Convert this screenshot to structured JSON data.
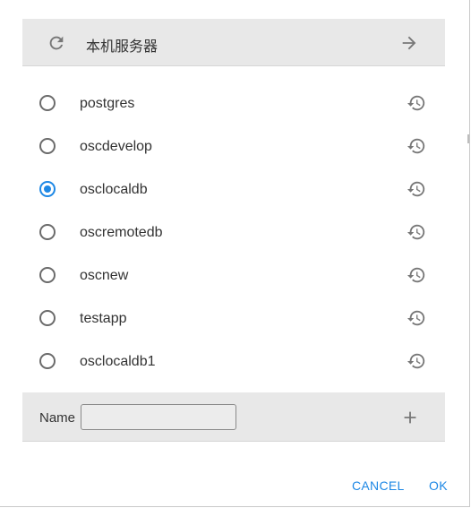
{
  "server": {
    "name": "本机服务器",
    "refresh_icon": "refresh-icon",
    "go_icon": "arrow-right-icon"
  },
  "databases": [
    {
      "name": "postgres",
      "selected": false
    },
    {
      "name": "oscdevelop",
      "selected": false
    },
    {
      "name": "osclocaldb",
      "selected": true
    },
    {
      "name": "oscremotedb",
      "selected": false
    },
    {
      "name": "oscnew",
      "selected": false
    },
    {
      "name": "testapp",
      "selected": false
    },
    {
      "name": "osclocaldb1",
      "selected": false
    }
  ],
  "add": {
    "label": "Name",
    "value": "",
    "add_icon": "plus-icon"
  },
  "actions": {
    "cancel": "CANCEL",
    "ok": "OK"
  },
  "colors": {
    "accent": "#1e88e5",
    "bar_background": "#e8e8e8",
    "icon": "#777777"
  }
}
